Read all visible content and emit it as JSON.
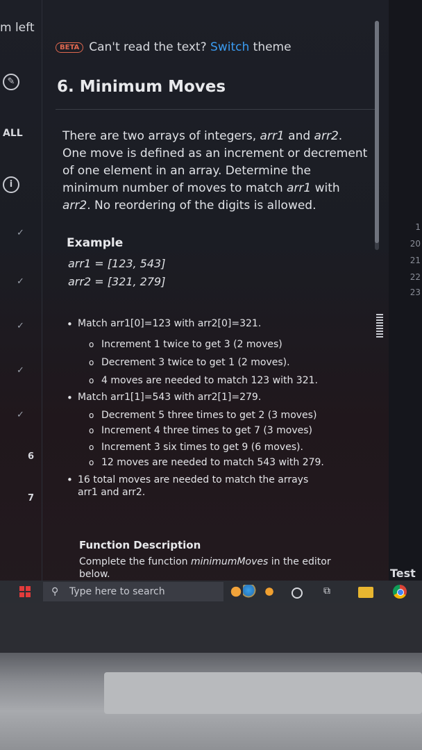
{
  "left_rail": {
    "time_left": "m left",
    "all_label": "ALL",
    "question_numbers": [
      "6",
      "7"
    ]
  },
  "banner": {
    "badge": "BETA",
    "prompt": "Can't read the text?",
    "switch_link": "Switch",
    "theme_word": "theme"
  },
  "problem": {
    "title": "6. Minimum Moves",
    "description": [
      "There are two arrays of integers, ",
      "arr1",
      " and ",
      "arr2",
      ". One move is defined as an increment or decrement of one element in an array. Determine the minimum number of moves to match ",
      "arr1",
      " with ",
      "arr2",
      ". No reordering of the digits is allowed."
    ],
    "example_title": "Example",
    "example_lines": [
      "arr1 = [123, 543]",
      "arr2 = [321, 279]"
    ],
    "explanation": [
      {
        "level": 1,
        "text": "Match arr1[0]=123 with arr2[0]=321."
      },
      {
        "level": 2,
        "text": "Increment 1 twice to get 3 (2 moves)"
      },
      {
        "level": 2,
        "text": "Decrement 3 twice to get 1 (2 moves)."
      },
      {
        "level": 2,
        "text": "4 moves are needed to match 123 with 321."
      },
      {
        "level": 1,
        "text": "Match arr1[1]=543 with arr2[1]=279."
      },
      {
        "level": 2,
        "text": "Decrement 5 three times to get 2 (3 moves)"
      },
      {
        "level": 2,
        "text": "Increment 4 three times to get 7 (3 moves)"
      },
      {
        "level": 2,
        "text": "Increment 3 six times to get 9 (6 moves)."
      },
      {
        "level": 2,
        "text": "12 moves are needed to match 543 with 279."
      },
      {
        "level": 1,
        "text": "16 total moves are needed to match the arrays arr1 and arr2."
      }
    ],
    "function_title": "Function Description",
    "function_desc_prefix": "Complete the function ",
    "function_name": "minimumMoves",
    "function_desc_suffix": " in the editor below."
  },
  "editor": {
    "line_numbers": [
      "1",
      "20",
      "21",
      "22",
      "23"
    ],
    "test_label": "Test I"
  },
  "taskbar": {
    "search_placeholder": "Type here to search"
  }
}
